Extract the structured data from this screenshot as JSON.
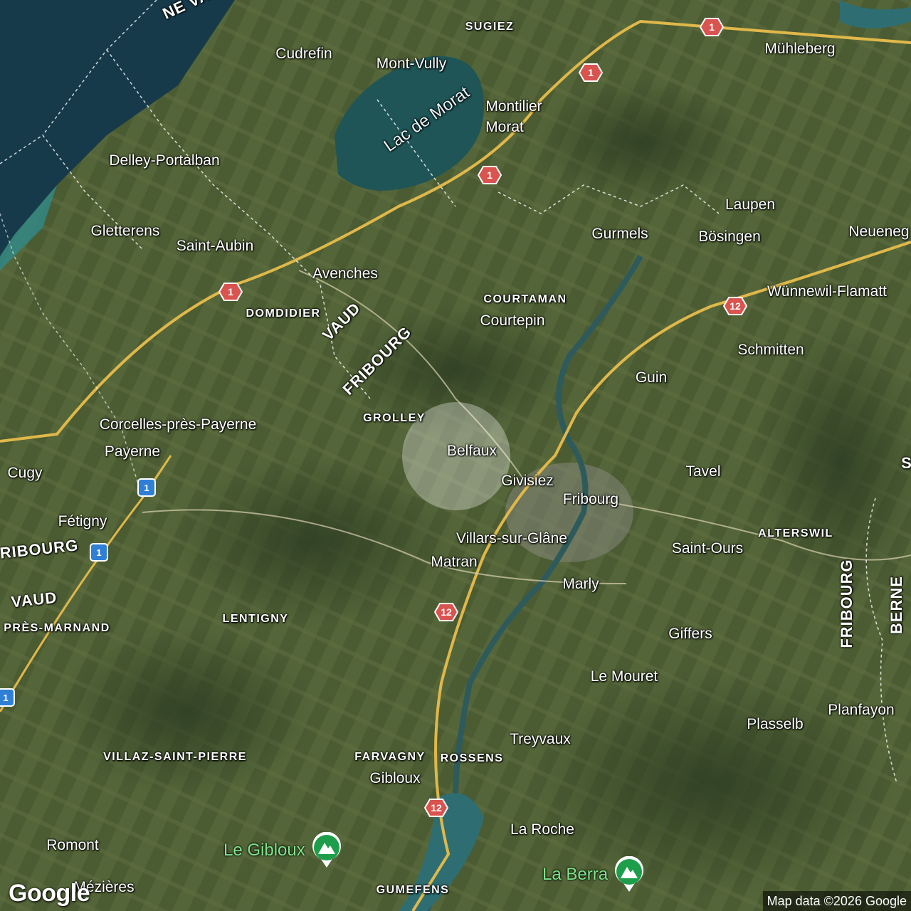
{
  "map": {
    "type": "satellite",
    "selection_label": "Belfaux",
    "places": [
      {
        "id": "sugiez",
        "text": "SUGIEZ",
        "style": "small-caps"
      },
      {
        "id": "cudrefin",
        "text": "Cudrefin",
        "style": "place"
      },
      {
        "id": "mont-vully",
        "text": "Mont-Vully",
        "style": "place"
      },
      {
        "id": "montilier",
        "text": "Montilier",
        "style": "place"
      },
      {
        "id": "morat",
        "text": "Morat",
        "style": "place"
      },
      {
        "id": "muhleberg",
        "text": "Mühleberg",
        "style": "place"
      },
      {
        "id": "delley-portalban",
        "text": "Delley-Portalban",
        "style": "place"
      },
      {
        "id": "gletterens",
        "text": "Gletterens",
        "style": "place"
      },
      {
        "id": "saint-aubin",
        "text": "Saint-Aubin",
        "style": "place"
      },
      {
        "id": "avenches",
        "text": "Avenches",
        "style": "place"
      },
      {
        "id": "laupen",
        "text": "Laupen",
        "style": "place"
      },
      {
        "id": "gurmels",
        "text": "Gurmels",
        "style": "place"
      },
      {
        "id": "bosingen",
        "text": "Bösingen",
        "style": "place"
      },
      {
        "id": "neueneg",
        "text": "Neueneg",
        "style": "place"
      },
      {
        "id": "domdidier",
        "text": "DOMDIDIER",
        "style": "small-caps"
      },
      {
        "id": "courtaman",
        "text": "COURTAMAN",
        "style": "small-caps"
      },
      {
        "id": "courtepin",
        "text": "Courtepin",
        "style": "place"
      },
      {
        "id": "wunnewil",
        "text": "Wünnewil-Flamatt",
        "style": "place"
      },
      {
        "id": "schmitten",
        "text": "Schmitten",
        "style": "place"
      },
      {
        "id": "guin",
        "text": "Guin",
        "style": "place"
      },
      {
        "id": "grolley",
        "text": "GROLLEY",
        "style": "small-caps"
      },
      {
        "id": "corcelles",
        "text": "Corcelles-près-Payerne",
        "style": "place"
      },
      {
        "id": "payerne",
        "text": "Payerne",
        "style": "place"
      },
      {
        "id": "belfaux",
        "text": "Belfaux",
        "style": "place"
      },
      {
        "id": "cugy",
        "text": "Cugy",
        "style": "place"
      },
      {
        "id": "givisiez",
        "text": "Givisiez",
        "style": "place"
      },
      {
        "id": "tavel",
        "text": "Tavel",
        "style": "place"
      },
      {
        "id": "fribourg-city",
        "text": "Fribourg",
        "style": "place"
      },
      {
        "id": "fetigny",
        "text": "Fétigny",
        "style": "place"
      },
      {
        "id": "villars",
        "text": "Villars-sur-Glâne",
        "style": "place"
      },
      {
        "id": "alterswil",
        "text": "ALTERSWIL",
        "style": "small-caps"
      },
      {
        "id": "saint-ours",
        "text": "Saint-Ours",
        "style": "place"
      },
      {
        "id": "matran",
        "text": "Matran",
        "style": "place"
      },
      {
        "id": "marly",
        "text": "Marly",
        "style": "place"
      },
      {
        "id": "pres-marnand",
        "text": "PRÈS-MARNAND",
        "style": "small-caps"
      },
      {
        "id": "lentigny",
        "text": "LENTIGNY",
        "style": "small-caps"
      },
      {
        "id": "giffers",
        "text": "Giffers",
        "style": "place"
      },
      {
        "id": "le-mouret",
        "text": "Le Mouret",
        "style": "place"
      },
      {
        "id": "planfayon",
        "text": "Planfayon",
        "style": "place"
      },
      {
        "id": "plasselb",
        "text": "Plasselb",
        "style": "place"
      },
      {
        "id": "treyvaux",
        "text": "Treyvaux",
        "style": "place"
      },
      {
        "id": "villaz",
        "text": "VILLAZ-SAINT-PIERRE",
        "style": "small-caps"
      },
      {
        "id": "farvagny",
        "text": "FARVAGNY",
        "style": "small-caps"
      },
      {
        "id": "rossens",
        "text": "ROSSENS",
        "style": "small-caps"
      },
      {
        "id": "gibloux",
        "text": "Gibloux",
        "style": "place"
      },
      {
        "id": "la-roche",
        "text": "La Roche",
        "style": "place"
      },
      {
        "id": "romont",
        "text": "Romont",
        "style": "place"
      },
      {
        "id": "mezieres",
        "text": "Mézières",
        "style": "place"
      },
      {
        "id": "gumefens",
        "text": "GUMEFENS",
        "style": "small-caps"
      }
    ],
    "regions": [
      {
        "id": "ne-va",
        "text": "NE   VA"
      },
      {
        "id": "vaud-1",
        "text": "VAUD"
      },
      {
        "id": "fribourg-1",
        "text": "FRIBOURG"
      },
      {
        "id": "fribourg-2",
        "text": "RIBOURG"
      },
      {
        "id": "vaud-2",
        "text": "VAUD"
      },
      {
        "id": "fribourg-3",
        "text": "FRIBOURG"
      },
      {
        "id": "berne",
        "text": "BERNE"
      },
      {
        "id": "s-edge",
        "text": "S"
      }
    ],
    "water": [
      {
        "id": "lac-de-morat",
        "text": "Lac de Morat"
      }
    ],
    "road_shields": [
      {
        "id": "s1",
        "number": "1",
        "color": "red"
      },
      {
        "id": "s2",
        "number": "1",
        "color": "red"
      },
      {
        "id": "s3",
        "number": "1",
        "color": "red"
      },
      {
        "id": "s4",
        "number": "1",
        "color": "red"
      },
      {
        "id": "s5",
        "number": "12",
        "color": "red"
      },
      {
        "id": "s6",
        "number": "1",
        "color": "blue"
      },
      {
        "id": "s7",
        "number": "1",
        "color": "blue"
      },
      {
        "id": "s8",
        "number": "12",
        "color": "red"
      },
      {
        "id": "s9",
        "number": "1",
        "color": "blue"
      },
      {
        "id": "s10",
        "number": "12",
        "color": "red"
      }
    ],
    "peaks": [
      {
        "id": "le-gibloux",
        "name": "Le Gibloux",
        "icon": "mountain-pin-icon"
      },
      {
        "id": "la-berra",
        "name": "La Berra",
        "icon": "mountain-pin-icon"
      }
    ]
  },
  "branding": {
    "logo_text": "Google",
    "attribution": "Map data ©2026 Google"
  },
  "colors": {
    "road_red": "#d9534f",
    "road_blue": "#2f7fd6",
    "peak_green": "#1e9e4a",
    "peak_label": "#7ee58c"
  }
}
